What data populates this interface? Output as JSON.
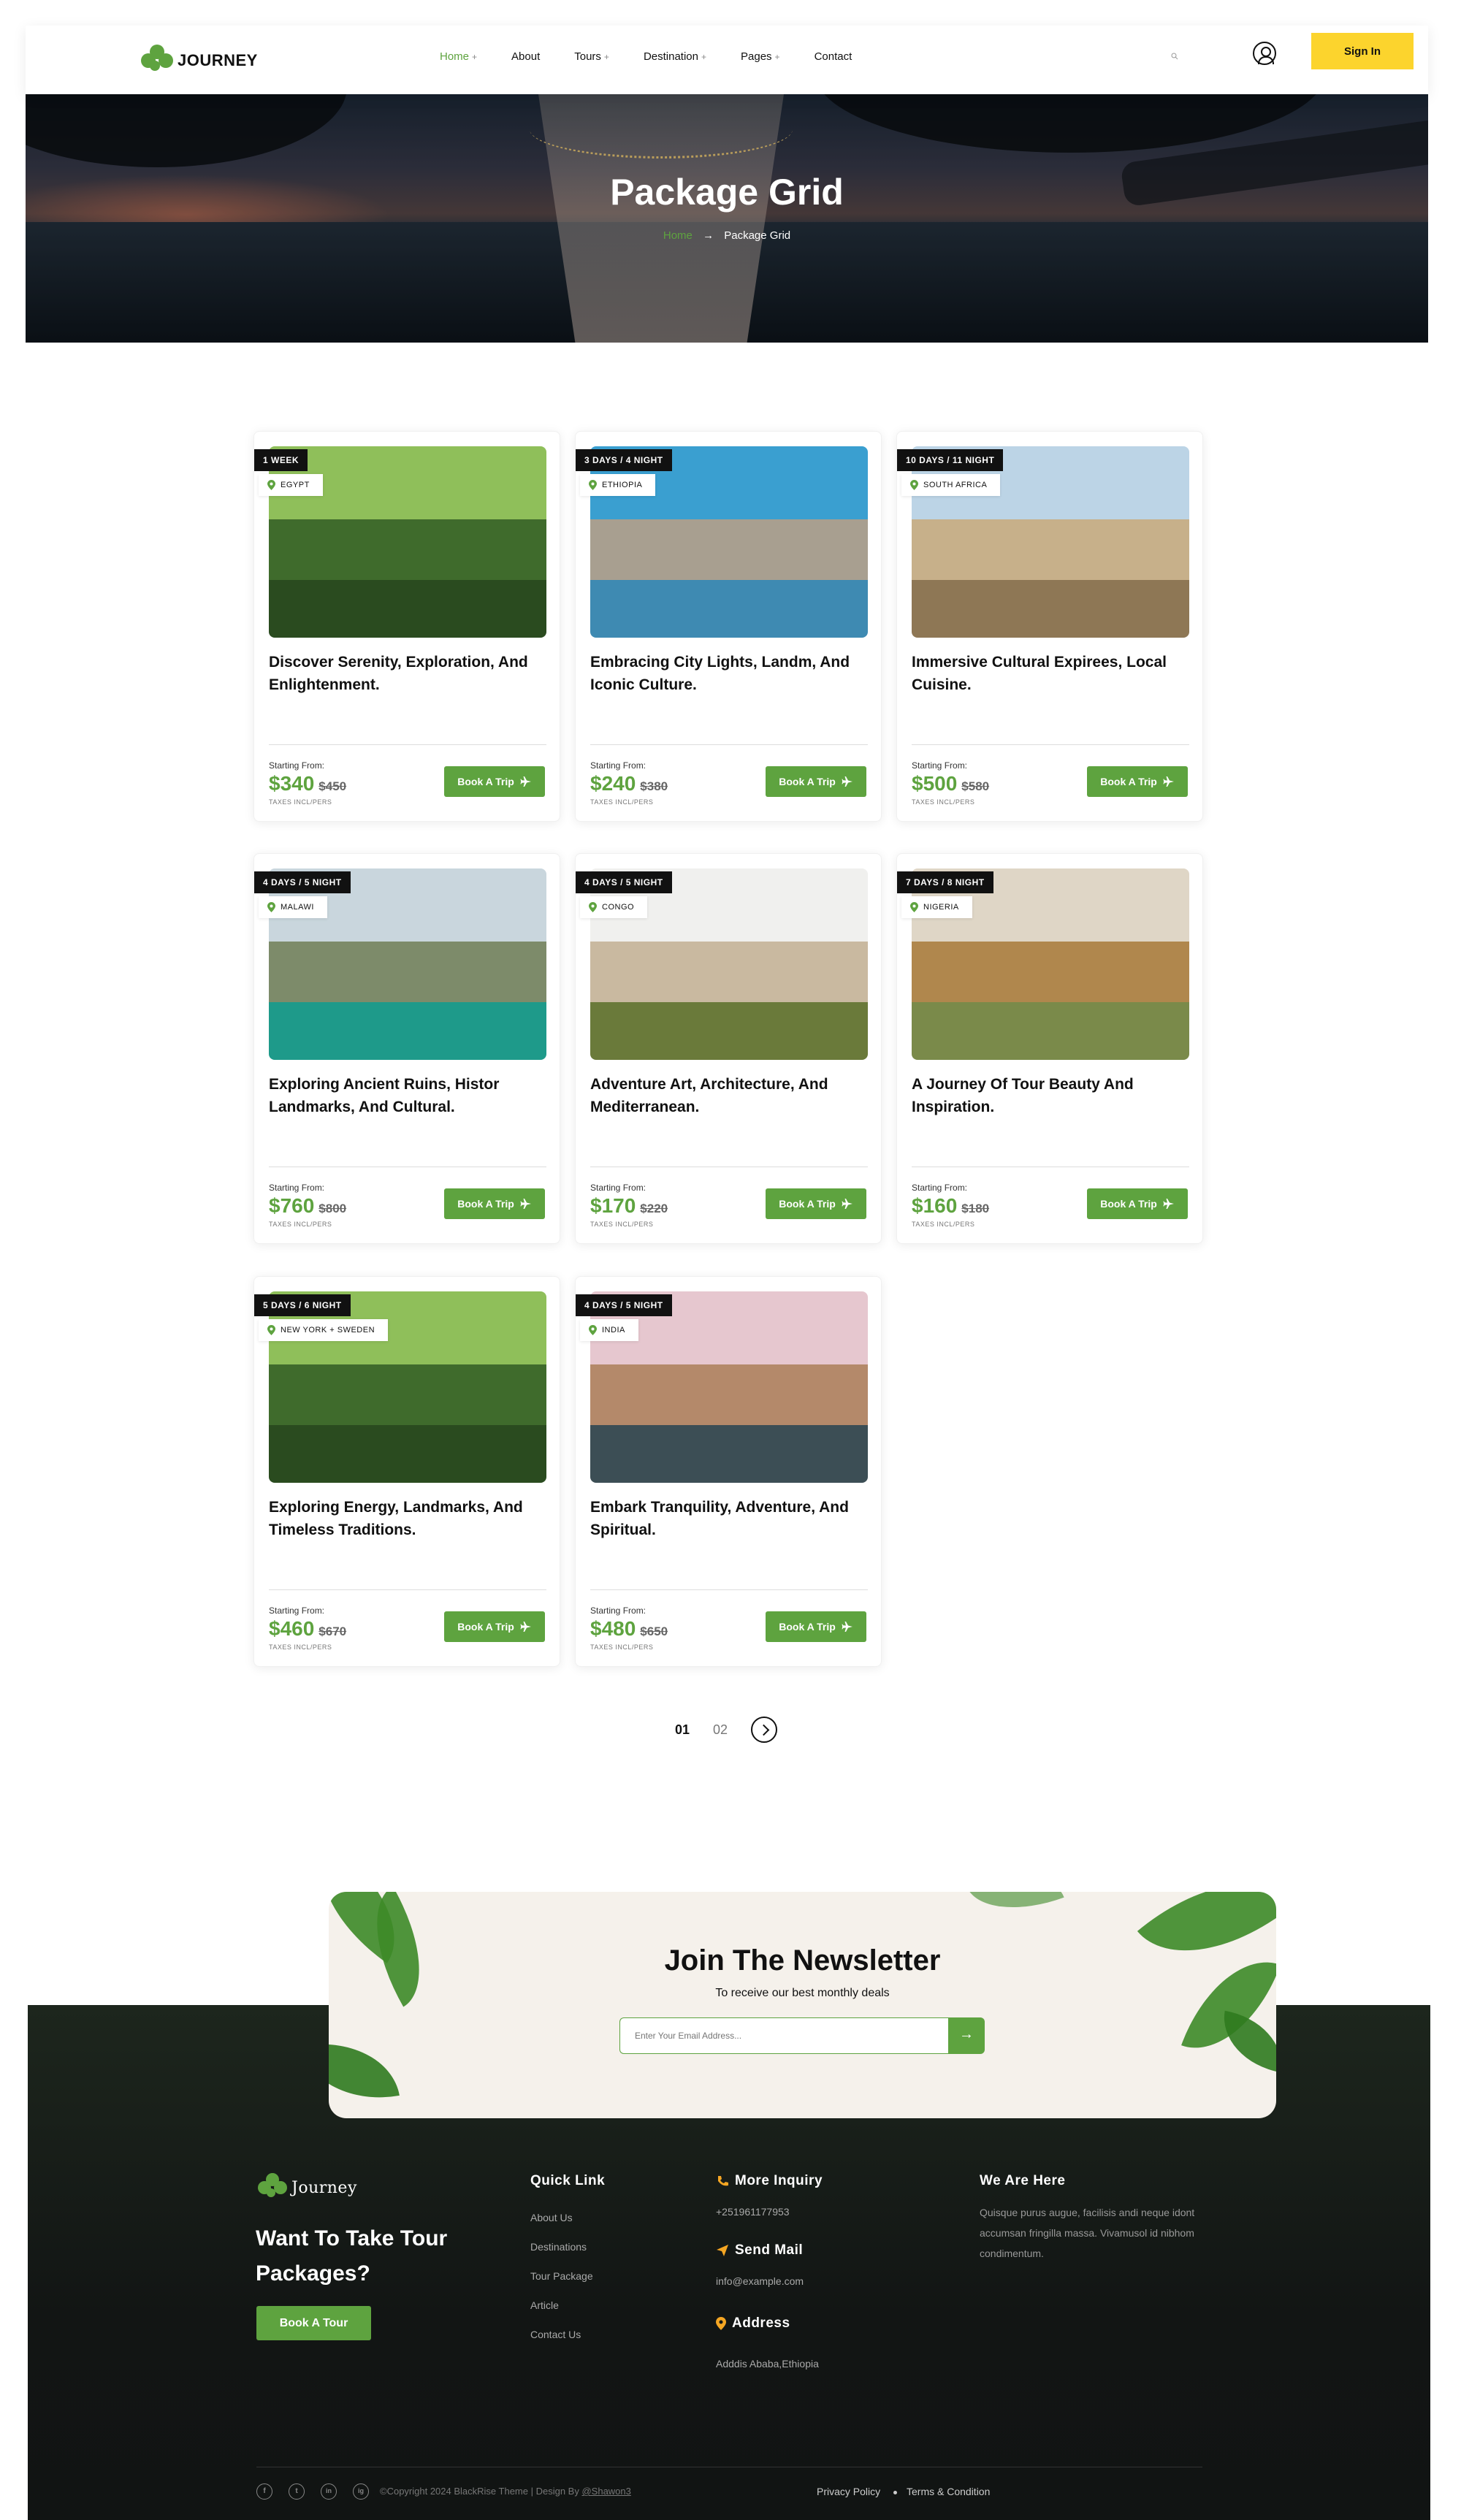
{
  "brand": {
    "name": "JOURNEY",
    "footer_name": "Journey",
    "accent": "#5ea33f",
    "signin_color": "#fcd42d"
  },
  "nav": {
    "items": [
      {
        "label": "Home",
        "suffix": "+",
        "active": true
      },
      {
        "label": "About",
        "suffix": ""
      },
      {
        "label": "Tours",
        "suffix": "+"
      },
      {
        "label": "Destination",
        "suffix": "+"
      },
      {
        "label": "Pages",
        "suffix": "+"
      },
      {
        "label": "Contact",
        "suffix": ""
      }
    ],
    "signin_label": "Sign In"
  },
  "hero": {
    "title": "Package Grid",
    "crumb_home": "Home",
    "crumb_current": "Package Grid"
  },
  "packages": [
    {
      "duration": "1 WEEK",
      "location": "EGYPT",
      "title": "Discover Serenity, Exploration, And Enlightenment.",
      "from": "Starting From:",
      "price": "$340",
      "old": "$450",
      "tax": "TAXES INCL/PERS",
      "cta": "Book A Trip"
    },
    {
      "duration": "3 DAYS / 4 NIGHT",
      "location": "ETHIOPIA",
      "title": "Embracing City Lights, Landm, And Iconic Culture.",
      "from": "Starting From:",
      "price": "$240",
      "old": "$380",
      "tax": "TAXES INCL/PERS",
      "cta": "Book A Trip"
    },
    {
      "duration": "10 DAYS / 11 NIGHT",
      "location": "SOUTH AFRICA",
      "title": "Immersive Cultural Expirees, Local Cuisine.",
      "from": "Starting From:",
      "price": "$500",
      "old": "$580",
      "tax": "TAXES INCL/PERS",
      "cta": "Book A Trip"
    },
    {
      "duration": "4 DAYS / 5 NIGHT",
      "location": "MALAWI",
      "title": "Exploring Ancient Ruins, Histor Landmarks, And Cultural.",
      "from": "Starting From:",
      "price": "$760",
      "old": "$800",
      "tax": "TAXES INCL/PERS",
      "cta": "Book A Trip"
    },
    {
      "duration": "4 DAYS / 5 NIGHT",
      "location": "CONGO",
      "title": "Adventure Art, Architecture, And Mediterranean.",
      "from": "Starting From:",
      "price": "$170",
      "old": "$220",
      "tax": "TAXES INCL/PERS",
      "cta": "Book A Trip"
    },
    {
      "duration": "7 DAYS / 8 NIGHT",
      "location": "NIGERIA",
      "title": "A Journey Of Tour Beauty And Inspiration.",
      "from": "Starting From:",
      "price": "$160",
      "old": "$180",
      "tax": "TAXES INCL/PERS",
      "cta": "Book A Trip"
    },
    {
      "duration": "5 DAYS / 6 NIGHT",
      "location": "NEW YORK + SWEDEN",
      "title": "Exploring Energy, Landmarks, And Timeless Traditions.",
      "from": "Starting From:",
      "price": "$460",
      "old": "$670",
      "tax": "TAXES INCL/PERS",
      "cta": "Book A Trip"
    },
    {
      "duration": "4 DAYS / 5 NIGHT",
      "location": "INDIA",
      "title": "Embark Tranquility, Adventure, And Spiritual.",
      "from": "Starting From:",
      "price": "$480",
      "old": "$650",
      "tax": "TAXES INCL/PERS",
      "cta": "Book A Trip"
    }
  ],
  "pagination": {
    "pages": [
      "01",
      "02"
    ],
    "current": "01"
  },
  "newsletter": {
    "title": "Join The Newsletter",
    "subtitle": "To receive our best monthly deals",
    "placeholder": "Enter Your Email Address..."
  },
  "footer": {
    "headline": "Want To Take Tour Packages?",
    "cta": "Book A Tour",
    "quick_title": "Quick Link",
    "quick_links": [
      "About Us",
      "Destinations",
      "Tour Package",
      "Article",
      "Contact Us"
    ],
    "inquiry_title": "More Inquiry",
    "phone": "+251961177953",
    "mail_title": "Send Mail",
    "email": "info@example.com",
    "address_title": "Address",
    "address": "Adddis Ababa,Ethiopia",
    "here_title": "We Are Here",
    "here_text": "Quisque purus augue, facilisis andi neque idont accumsan fringilla massa. Vivamusol id nibhom condimentum.",
    "social": [
      "f",
      "t",
      "in",
      "ig"
    ],
    "copyright": "©Copyright 2024 BlackRise Theme | Design By",
    "designer": "@Shawon3",
    "privacy": "Privacy Policy",
    "terms": "Terms & Condition"
  }
}
